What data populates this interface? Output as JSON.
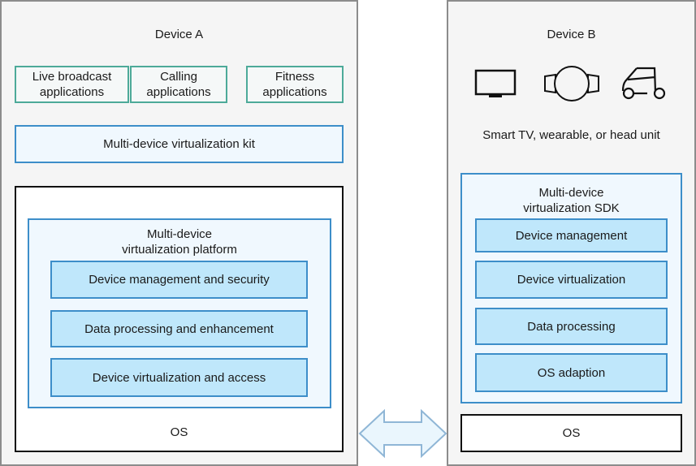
{
  "device_a": {
    "title": "Device A",
    "apps": [
      {
        "label": "Live broadcast applications"
      },
      {
        "label": "Calling applications"
      },
      {
        "label": "Fitness applications"
      }
    ],
    "kit": "Multi-device virtualization kit",
    "platform": {
      "title_line1": "Multi-device",
      "title_line2": "virtualization platform",
      "modules": [
        {
          "label": "Device management and security"
        },
        {
          "label": "Data processing and enhancement"
        },
        {
          "label": "Device virtualization and access"
        }
      ]
    },
    "os": "OS"
  },
  "device_b": {
    "title": "Device B",
    "icons": [
      "tv-icon",
      "wearable-icon",
      "car-icon"
    ],
    "caption": "Smart TV, wearable, or head unit",
    "sdk": {
      "title_line1": "Multi-device",
      "title_line2": "virtualization SDK",
      "modules": [
        {
          "label": "Device management"
        },
        {
          "label": "Device virtualization"
        },
        {
          "label": "Data processing"
        },
        {
          "label": "OS adaption"
        }
      ]
    },
    "os": "OS"
  },
  "connector": {
    "icon": "bidirectional-arrow-icon"
  },
  "colors": {
    "panel_bg": "#f5f5f5",
    "panel_border": "#8c8c8c",
    "app_border": "#4daa99",
    "module_fill": "#bfe7fb",
    "module_border": "#3d8ec9",
    "arrow_fill": "#eaf6fd",
    "arrow_stroke": "#8fb6d6"
  }
}
